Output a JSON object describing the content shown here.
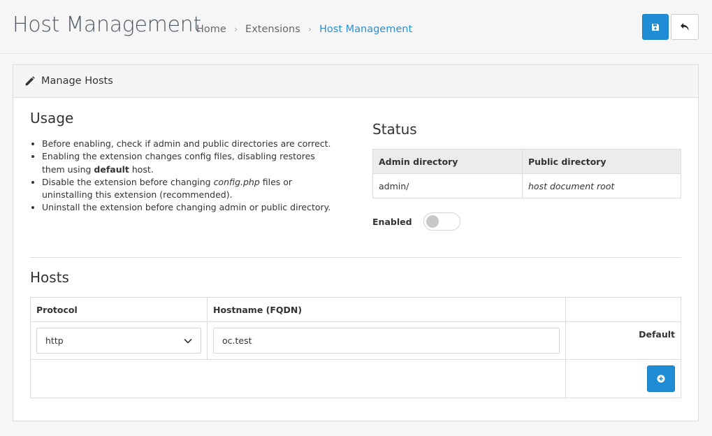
{
  "header": {
    "title": "Host Management",
    "breadcrumb": [
      "Home",
      "Extensions",
      "Host Management"
    ],
    "save_icon": "floppy-disk-icon",
    "back_icon": "reply-arrow-icon"
  },
  "panel": {
    "title": "Manage Hosts",
    "title_icon": "pencil-icon"
  },
  "usage": {
    "heading": "Usage",
    "items": {
      "item1": "Before enabling, check if admin and public directories are correct.",
      "item2_pre": "Enabling the extension changes config files, disabling restores them using ",
      "item2_bold": "default",
      "item2_post": " host.",
      "item3_pre": "Disable the extension before changing ",
      "item3_italic": "config.php",
      "item3_post": " files or uninstalling this extension (recommended).",
      "item4": "Uninstall the extension before changing admin or public directory."
    }
  },
  "status": {
    "heading": "Status",
    "columns": [
      "Admin directory",
      "Public directory"
    ],
    "admin_value": "admin/",
    "public_value": "host document root",
    "enabled_label": "Enabled",
    "enabled": false
  },
  "hosts": {
    "heading": "Hosts",
    "columns": [
      "Protocol",
      "Hostname (FQDN)",
      ""
    ],
    "rows": [
      {
        "protocol": "http",
        "hostname": "oc.test",
        "default_label": "Default"
      }
    ],
    "add_icon": "plus-circle-icon"
  },
  "colors": {
    "primary": "#1f8dd6",
    "breadcrumb_active": "#2b8fd0"
  }
}
